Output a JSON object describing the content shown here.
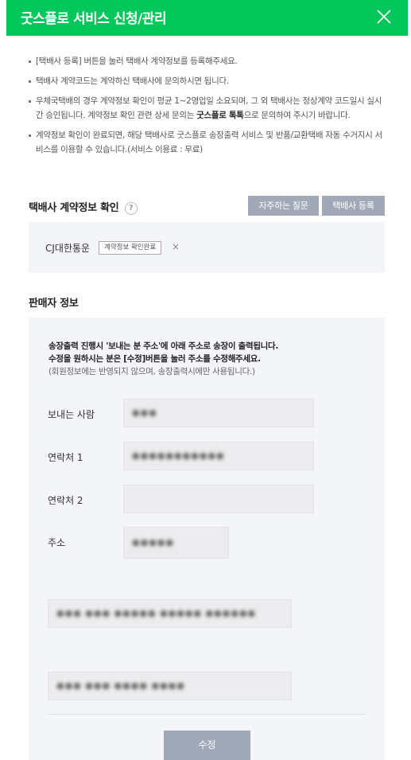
{
  "header": {
    "title": "굿스플로 서비스 신청/관리",
    "close_icon": "close-icon"
  },
  "notices": [
    "[택배사 등록] 버튼을 눌러 택배사 계약정보를 등록해주세요.",
    "택배사 계약코드는 계약하신 택배사에 문의하시면 됩니다.",
    "우체국택배의 경우 계약정보 확인이 평균 1~2영업일 소요되며, 그 외 택배사는 정상계약 코드일시 실시간 승인됩니다. 계약정보 확인 관련 상세 문의는 굿스플로 톡톡으로 문의하여 주시기 바랍니다.",
    "계약정보 확인이 완료되면, 해당 택배사로 굿스플로 송장출력 서비스 및 반품/교환택배 자동 수거지시 서비스를 이용할 수 있습니다.(서비스 이용료 : 무료)"
  ],
  "contract": {
    "title": "택배사 계약정보 확인",
    "help_icon": "?",
    "faq_button": "자주하는 질문",
    "register_button": "택배사 등록",
    "courier_name": "CJ대한통운",
    "courier_status": "계약정보 확인완료",
    "remove_icon": "×"
  },
  "seller": {
    "title": "판매자 정보",
    "intro_line1": "송장출력 진행시 '보내는 분 주소'에 아래 주소로 송장이 출력됩니다.",
    "intro_line2": "수정을 원하시는 분은 [수정]버튼을 눌러 주소를 수정해주세요.",
    "intro_line3": "(회원정보에는 반영되지 않으며, 송장출력시에만 사용됩니다.)",
    "sender_label": "보내는 사람",
    "sender_value": "●●●",
    "phone1_label": "연락처 1",
    "phone1_value": "●●●●●●●●●●●",
    "phone2_label": "연락처 2",
    "phone2_value": "",
    "address_label": "주소",
    "zipcode_value": "●●●●●",
    "address1_value": "●●● ●●● ●●●●● ●●●●● ●●●●●● ●●●●●",
    "address2_value": "●●● ●●● ●●●● ●●●●",
    "edit_button": "수정"
  }
}
